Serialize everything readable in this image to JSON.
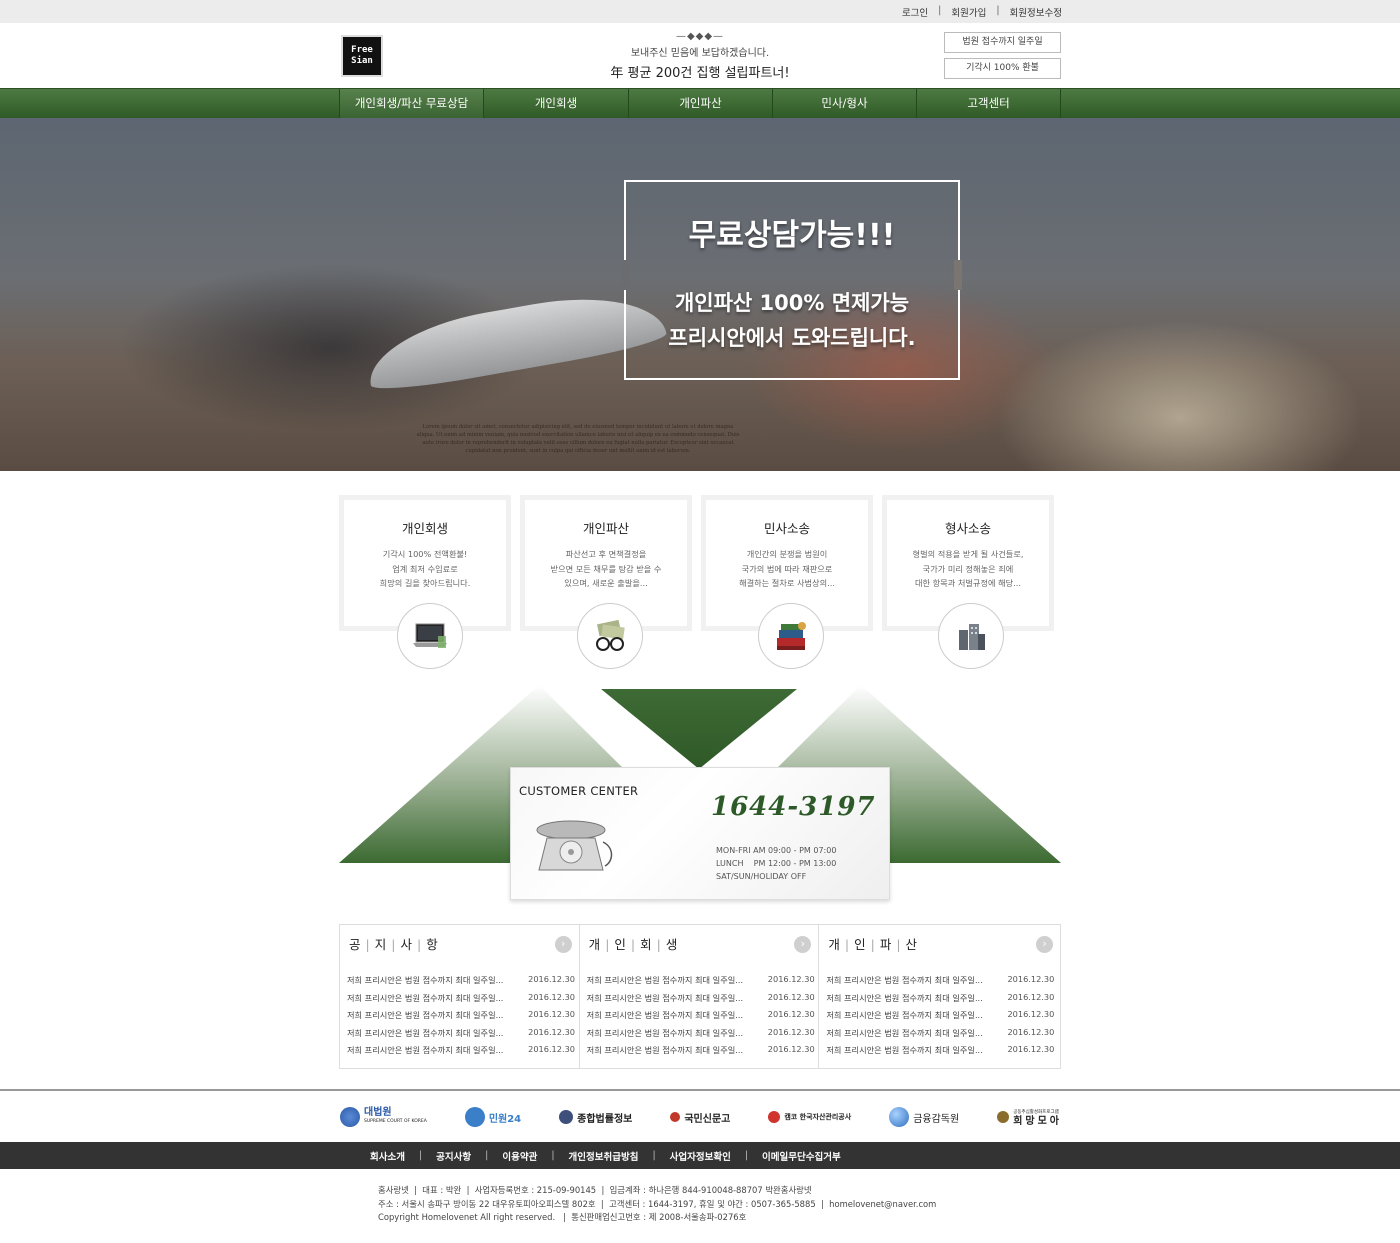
{
  "top_links": [
    "로그인",
    "회원가입",
    "회원정보수정"
  ],
  "logo": {
    "line1": "Free",
    "line2": "Sian"
  },
  "tagline": {
    "ornament": "—◆◆◆—",
    "line1": "보내주신 믿음에 보답하겠습니다.",
    "line2": "年 평균 200건 집행 설립파트너!"
  },
  "header_buttons": [
    "법원 접수까지 일주일",
    "기각시 100% 환불"
  ],
  "nav": [
    "개인회생/파산 무료상담",
    "개인회생",
    "개인파산",
    "민사/형사",
    "고객센터"
  ],
  "hero": {
    "headline": "무료상담가능!!!",
    "sub1": "개인파산 100% 면제가능",
    "sub2": "프리시안에서 도와드립니다.",
    "lorem": "Lorem ipsum dolor sit amet, consectetur adipisicing elit, sed do eiusmod tempor incididunt ut labore et dolore magna aliqua. Ut enim ad minim veniam, quis nostrud exercitation ullamco laboris nisi ut aliquip ex ea commodo consequat. Duis aute irure dolor in reprehenderit in voluptate velit esse cillum dolore eu fugiat nulla pariatur. Excepteur sint occaecat cupidatat non proident, sunt in culpa qui officia deser unt mollit anim id est laborum."
  },
  "services": [
    {
      "title": "개인회생",
      "desc": [
        "기각시 100% 전액환불!",
        "업계 최저 수임료로",
        "희망의 길을 찾아드립니다."
      ],
      "icon": "laptop-icon"
    },
    {
      "title": "개인파산",
      "desc": [
        "파산선고 후 면책결정을",
        "받으면 모든 채무를 탕감 받을 수",
        "있으며, 새로운 출발을..."
      ],
      "icon": "money-glasses-icon"
    },
    {
      "title": "민사소송",
      "desc": [
        "개인간의 분쟁을 법원이",
        "국가의 법에 따라 재판으로",
        "해결하는 절차로 사법상의..."
      ],
      "icon": "books-icon"
    },
    {
      "title": "형사소송",
      "desc": [
        "형벌의 적용을 받게 될 사건들로,",
        "국가가 미리 정해놓은 죄에",
        "대한 항목과 처벌규정에 해당..."
      ],
      "icon": "buildings-icon"
    }
  ],
  "customer_center": {
    "title": "CUSTOMER CENTER",
    "phone": "1644-3197",
    "hours": [
      "MON-FRI AM 09:00 - PM 07:00",
      "LUNCH    PM 12:00 - PM 13:00",
      "SAT/SUN/HOLIDAY OFF"
    ]
  },
  "boards": [
    {
      "title": [
        "공",
        "지",
        "사",
        "항"
      ],
      "items": [
        {
          "t": "저희 프리시안은 법원 접수까지 최대 일주일...",
          "d": "2016.12.30"
        },
        {
          "t": "저희 프리시안은 법원 접수까지 최대 일주일...",
          "d": "2016.12.30"
        },
        {
          "t": "저희 프리시안은 법원 접수까지 최대 일주일...",
          "d": "2016.12.30"
        },
        {
          "t": "저희 프리시안은 법원 접수까지 최대 일주일...",
          "d": "2016.12.30"
        },
        {
          "t": "저희 프리시안은 법원 접수까지 최대 일주일...",
          "d": "2016.12.30"
        }
      ]
    },
    {
      "title": [
        "개",
        "인",
        "회",
        "생"
      ],
      "items": [
        {
          "t": "저희 프리시안은 법원 접수까지 최대 일주일...",
          "d": "2016.12.30"
        },
        {
          "t": "저희 프리시안은 법원 접수까지 최대 일주일...",
          "d": "2016.12.30"
        },
        {
          "t": "저희 프리시안은 법원 접수까지 최대 일주일...",
          "d": "2016.12.30"
        },
        {
          "t": "저희 프리시안은 법원 접수까지 최대 일주일...",
          "d": "2016.12.30"
        },
        {
          "t": "저희 프리시안은 법원 접수까지 최대 일주일...",
          "d": "2016.12.30"
        }
      ]
    },
    {
      "title": [
        "개",
        "인",
        "파",
        "산"
      ],
      "items": [
        {
          "t": "저희 프리시안은 법원 접수까지 최대 일주일...",
          "d": "2016.12.30"
        },
        {
          "t": "저희 프리시안은 법원 접수까지 최대 일주일...",
          "d": "2016.12.30"
        },
        {
          "t": "저희 프리시안은 법원 접수까지 최대 일주일...",
          "d": "2016.12.30"
        },
        {
          "t": "저희 프리시안은 법원 접수까지 최대 일주일...",
          "d": "2016.12.30"
        },
        {
          "t": "저희 프리시안은 법원 접수까지 최대 일주일...",
          "d": "2016.12.30"
        }
      ]
    }
  ],
  "partners": [
    {
      "name": "대법원",
      "sub": "SUPREME COURT OF KOREA",
      "color": "#2b5aa8"
    },
    {
      "name": "민원24",
      "sub": "",
      "color": "#3a7fc8"
    },
    {
      "name": "종합법률정보",
      "sub": "",
      "color": "#3d4f7a"
    },
    {
      "name": "국민신문고",
      "sub": "",
      "color": "#c0392b"
    },
    {
      "name": "캠코 한국자산관리공사",
      "sub": "",
      "color": "#d0342c"
    },
    {
      "name": "금융감독원",
      "sub": "",
      "color": "#2f6fc0"
    },
    {
      "name": "희망모아",
      "sub": "공동추심활성화프로그램",
      "color": "#8a6d2c"
    }
  ],
  "footer_nav": [
    "회사소개",
    "공지사항",
    "이용약관",
    "개인정보취급방침",
    "사업자정보확인",
    "이메일무단수집거부"
  ],
  "footer_info": [
    "홈사랑넷  |  대표 : 박완  |  사업자등록번호 : 215-09-90145  |  입금계좌 : 하나은행 844-910048-88707 박완홈사랑넷",
    "주소 : 서울시 송파구 방이동 22 대우유토피아오피스텔 802호  |  고객센터 : 1644-3197, 휴일 및 야간 : 0507-365-5885  |  homelovenet@naver.com",
    "Copyright Homelovenet All right reserved.   |  통신판매업신고번호 : 제 2008-서울송파-0276호"
  ],
  "colors": {
    "brand_green": "#3b6a31",
    "dark_footer": "#333333"
  }
}
